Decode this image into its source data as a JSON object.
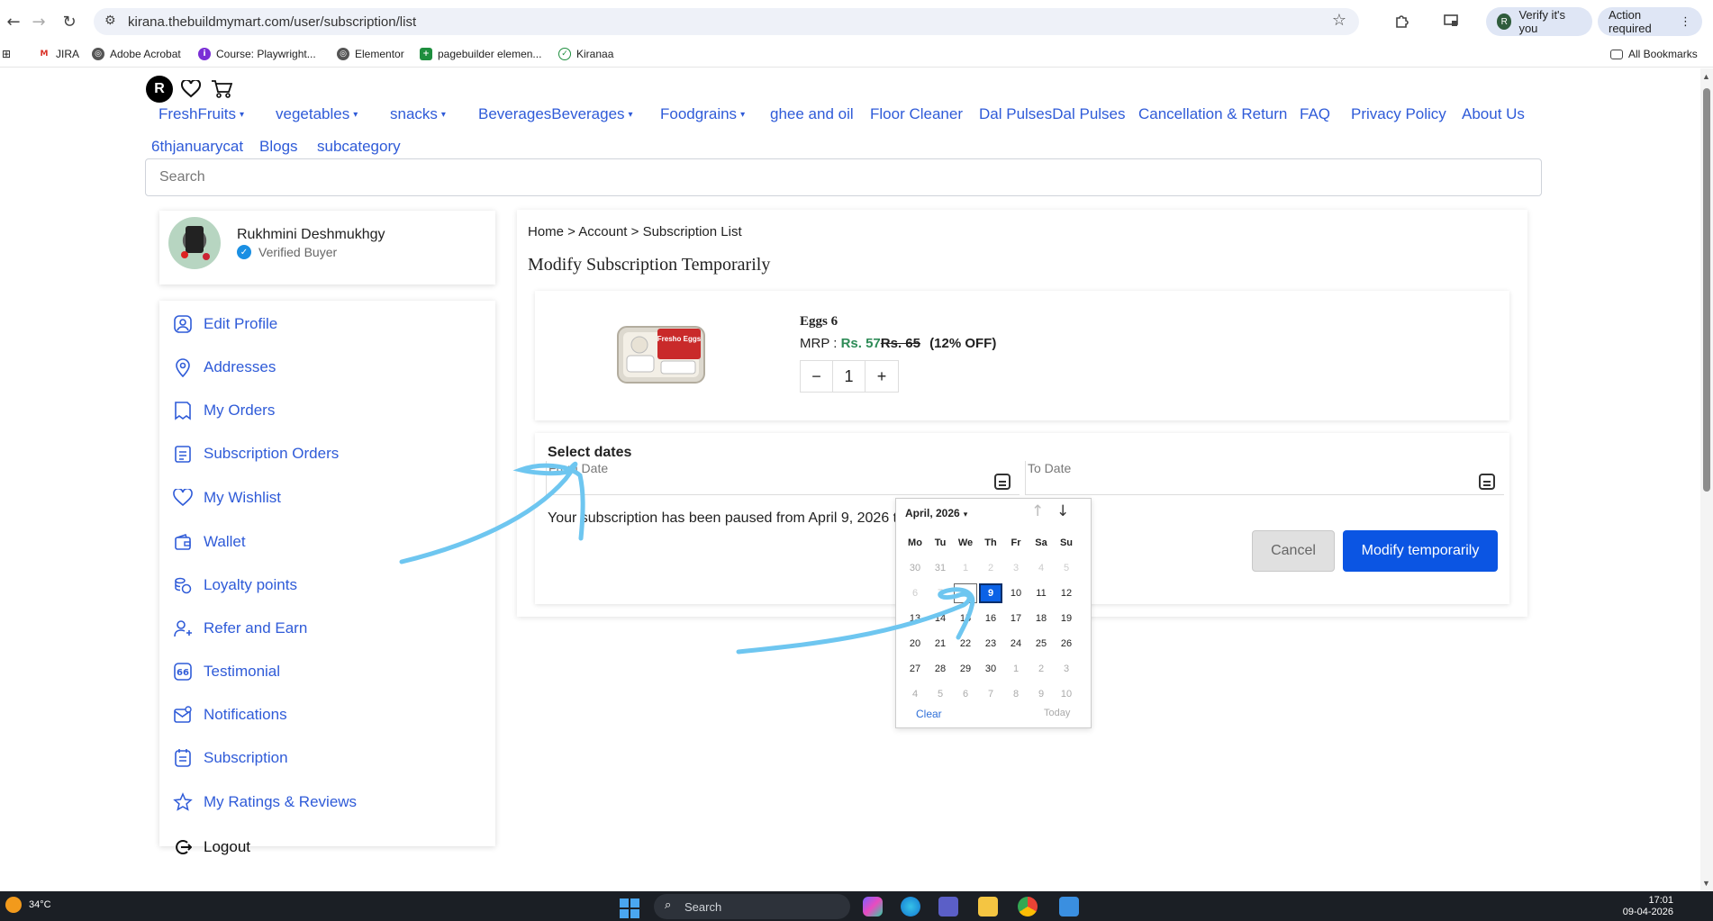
{
  "browser": {
    "url": "kirana.thebuildmymart.com/user/subscription/list",
    "verify_label": "Verify it's you",
    "verify_avatar": "R",
    "action_label": "Action required",
    "bookmarks": [
      "JIRA",
      "Adobe Acrobat",
      "Course: Playwright...",
      "Elementor",
      "pagebuilder elemen...",
      "Kiranaa"
    ],
    "all_bookmarks": "All Bookmarks"
  },
  "site": {
    "avatar_letter": "R",
    "menu_row1": [
      {
        "label": "FreshFruits",
        "dropdown": true
      },
      {
        "label": "vegetables",
        "dropdown": true
      },
      {
        "label": "snacks",
        "dropdown": true
      },
      {
        "label": "BeveragesBeverages",
        "dropdown": true
      },
      {
        "label": "Foodgrains",
        "dropdown": true
      },
      {
        "label": "ghee and oil",
        "dropdown": false
      },
      {
        "label": "Floor Cleaner",
        "dropdown": false
      },
      {
        "label": "Dal PulsesDal Pulses",
        "dropdown": false
      },
      {
        "label": "Cancellation & Return",
        "dropdown": false
      },
      {
        "label": "FAQ",
        "dropdown": false
      },
      {
        "label": "Privacy Policy",
        "dropdown": false
      },
      {
        "label": "About Us",
        "dropdown": false
      }
    ],
    "menu_row2": [
      "6thjanuarycat",
      "Blogs",
      "subcategory"
    ],
    "search_placeholder": "Search"
  },
  "profile": {
    "name": "Rukhmini Deshmukhgy",
    "status": "Verified Buyer"
  },
  "sidebar": {
    "items": [
      {
        "label": "Edit Profile",
        "icon": "user-circle-icon"
      },
      {
        "label": "Addresses",
        "icon": "location-pin-icon"
      },
      {
        "label": "My Orders",
        "icon": "orders-icon"
      },
      {
        "label": "Subscription Orders",
        "icon": "subscription-orders-icon"
      },
      {
        "label": "My Wishlist",
        "icon": "heart-icon"
      },
      {
        "label": "Wallet",
        "icon": "wallet-icon"
      },
      {
        "label": "Loyalty points",
        "icon": "coins-icon"
      },
      {
        "label": "Refer and Earn",
        "icon": "refer-user-icon"
      },
      {
        "label": "Testimonial",
        "icon": "quote-icon"
      },
      {
        "label": "Notifications",
        "icon": "mail-icon"
      },
      {
        "label": "Subscription",
        "icon": "subscription-icon"
      },
      {
        "label": "My Ratings & Reviews",
        "icon": "star-icon"
      }
    ],
    "logout": "Logout"
  },
  "main": {
    "breadcrumb": "Home > Account > Subscription List",
    "title": "Modify Subscription Temporarily",
    "product": {
      "name": "Eggs 6",
      "mrp_label": "MRP :",
      "price": "Rs. 57",
      "mrp": "Rs. 65",
      "discount": "(12% OFF)",
      "qty_minus": "−",
      "quantity": "1",
      "qty_plus": "+",
      "image_label": "Fresho Eggs"
    },
    "dates": {
      "title": "Select dates",
      "from_label": "From Date",
      "to_label": "To Date",
      "status_message": "Your subscription has been paused from April 9, 2026 to April 9, 2026 12:00 am."
    },
    "cancel_label": "Cancel",
    "modify_label": "Modify temporarily"
  },
  "datepicker": {
    "month_label": "April, 2026",
    "weekdays": [
      "Mo",
      "Tu",
      "We",
      "Th",
      "Fr",
      "Sa",
      "Su"
    ],
    "weeks": [
      [
        {
          "d": "30",
          "s": "muted"
        },
        {
          "d": "31",
          "s": "muted"
        },
        {
          "d": "1",
          "s": "disabled"
        },
        {
          "d": "2",
          "s": "disabled"
        },
        {
          "d": "3",
          "s": "disabled"
        },
        {
          "d": "4",
          "s": "disabled"
        },
        {
          "d": "5",
          "s": "disabled"
        }
      ],
      [
        {
          "d": "6",
          "s": "disabled"
        },
        {
          "d": "7",
          "s": "disabled"
        },
        {
          "d": "8",
          "s": "outline"
        },
        {
          "d": "9",
          "s": "selected"
        },
        {
          "d": "10",
          "s": ""
        },
        {
          "d": "11",
          "s": ""
        },
        {
          "d": "12",
          "s": ""
        }
      ],
      [
        {
          "d": "13",
          "s": ""
        },
        {
          "d": "14",
          "s": ""
        },
        {
          "d": "15",
          "s": ""
        },
        {
          "d": "16",
          "s": ""
        },
        {
          "d": "17",
          "s": ""
        },
        {
          "d": "18",
          "s": ""
        },
        {
          "d": "19",
          "s": ""
        }
      ],
      [
        {
          "d": "20",
          "s": ""
        },
        {
          "d": "21",
          "s": ""
        },
        {
          "d": "22",
          "s": ""
        },
        {
          "d": "23",
          "s": ""
        },
        {
          "d": "24",
          "s": ""
        },
        {
          "d": "25",
          "s": ""
        },
        {
          "d": "26",
          "s": ""
        }
      ],
      [
        {
          "d": "27",
          "s": ""
        },
        {
          "d": "28",
          "s": ""
        },
        {
          "d": "29",
          "s": ""
        },
        {
          "d": "30",
          "s": ""
        },
        {
          "d": "1",
          "s": "muted"
        },
        {
          "d": "2",
          "s": "muted"
        },
        {
          "d": "3",
          "s": "muted"
        }
      ],
      [
        {
          "d": "4",
          "s": "muted"
        },
        {
          "d": "5",
          "s": "muted"
        },
        {
          "d": "6",
          "s": "muted"
        },
        {
          "d": "7",
          "s": "muted"
        },
        {
          "d": "8",
          "s": "muted"
        },
        {
          "d": "9",
          "s": "muted"
        },
        {
          "d": "10",
          "s": "muted"
        }
      ]
    ],
    "clear_label": "Clear",
    "today_label": "Today"
  },
  "taskbar": {
    "temperature": "34°C",
    "search_label": "Search",
    "time": "17:01",
    "date": "09-04-2026"
  },
  "colors": {
    "link_blue": "#2f5bd8",
    "primary_button": "#0b55e3",
    "sale_green": "#2e8b57",
    "annotation_stroke": "#6ec6f0"
  }
}
